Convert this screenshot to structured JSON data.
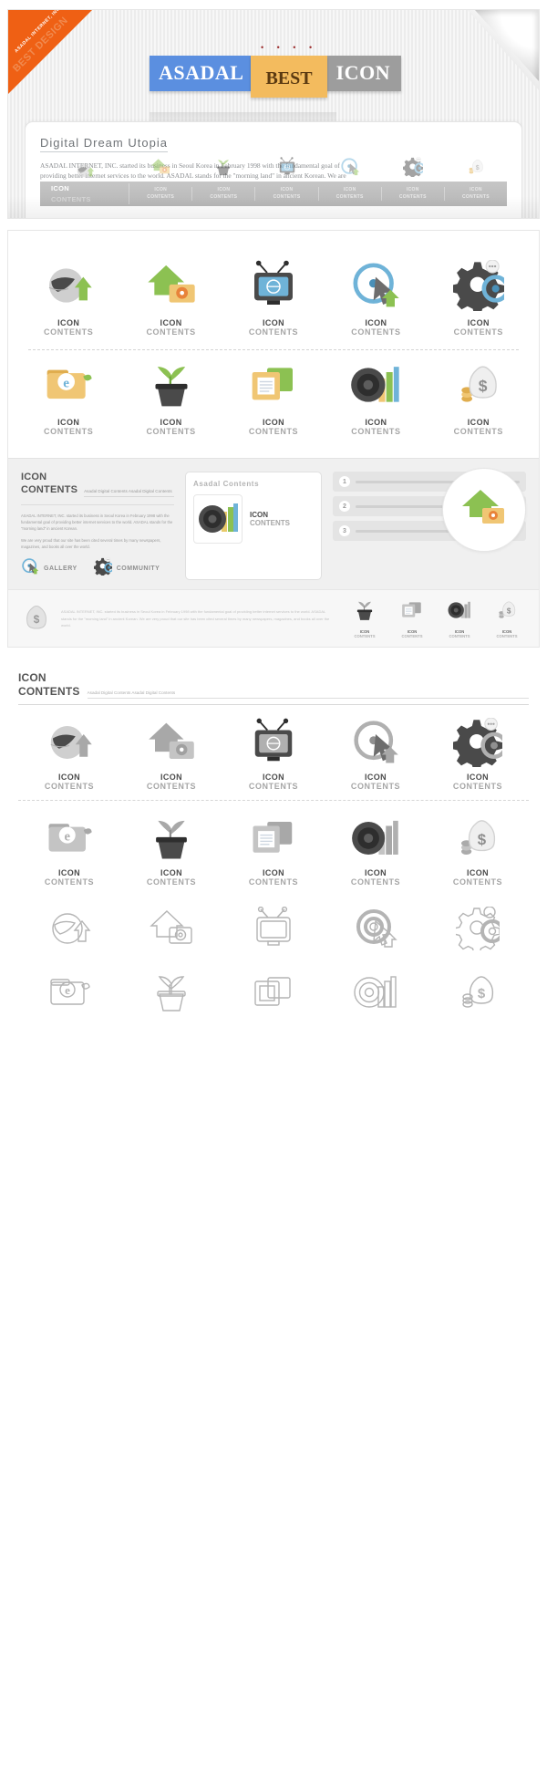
{
  "hero": {
    "ribbon_line1": "ASADAL INTERNET, INC.",
    "ribbon_line2": "BEST DESIGN",
    "logo": {
      "blue": "ASADAL",
      "yellow": "BEST",
      "gray": "ICON",
      "dots": "• • • •"
    },
    "card_title": "Digital  Dream  Utopia",
    "card_body": "ASADAL INTERNET, INC. started its business in Seoul Korea in February 1998 with the fundamental goal of providing better internet services to the world. ASADAL stands for the \"morning land\" in ancient Korean. We are very proud that our site has been cited several times by many newspapers, magazines, and books all over the world.",
    "nav": [
      {
        "l1": "ICON",
        "l2": "CONTENTS",
        "icon": "globe-icon"
      },
      {
        "l1": "ICON",
        "l2": "CONTENTS",
        "icon": "home-mail-icon"
      },
      {
        "l1": "ICON",
        "l2": "CONTENTS",
        "icon": "plant-pot-icon"
      },
      {
        "l1": "ICON",
        "l2": "CONTENTS",
        "icon": "tv-icon"
      },
      {
        "l1": "ICON",
        "l2": "CONTENTS",
        "icon": "target-cursor-icon"
      },
      {
        "l1": "ICON",
        "l2": "CONTENTS",
        "icon": "gear-icon"
      },
      {
        "l1": "ICON",
        "l2": "CONTENTS",
        "icon": "money-bag-icon"
      }
    ]
  },
  "icon_card": {
    "row1": [
      {
        "icon": "globe-arrow-icon",
        "l1": "ICON",
        "l2": "CONTENTS"
      },
      {
        "icon": "home-mail-icon",
        "l1": "ICON",
        "l2": "CONTENTS"
      },
      {
        "icon": "tv-globe-icon",
        "l1": "ICON",
        "l2": "CONTENTS"
      },
      {
        "icon": "target-cursor-icon",
        "l1": "ICON",
        "l2": "CONTENTS"
      },
      {
        "icon": "gear-chat-icon",
        "l1": "ICON",
        "l2": "CONTENTS"
      }
    ],
    "row2": [
      {
        "icon": "folder-internet-icon",
        "l1": "ICON",
        "l2": "CONTENTS"
      },
      {
        "icon": "plant-pot-icon",
        "l1": "ICON",
        "l2": "CONTENTS"
      },
      {
        "icon": "documents-icon",
        "l1": "ICON",
        "l2": "CONTENTS"
      },
      {
        "icon": "speaker-chart-icon",
        "l1": "ICON",
        "l2": "CONTENTS"
      },
      {
        "icon": "money-bag-coins-icon",
        "l1": "ICON",
        "l2": "CONTENTS"
      }
    ]
  },
  "info": {
    "h1": "ICON",
    "h2": "CONTENTS",
    "subtitle": "Asadal Digital Contents  Asadal Digital Contents",
    "p1": "ASADAL INTERNET, INC. started its business in Seoul Korea in February 1998 with the fundamental goal of providing better internet services to the world. ASADAL stands for the \"morning land\" in ancient Korean.",
    "p2": "We are very proud that our site has been cited several times by many newspapers, magazines, and books all over the world.",
    "links": [
      {
        "label": "GALLERY",
        "icon": "target-cursor-icon"
      },
      {
        "label": "COMMUNITY",
        "icon": "gear-chat-icon"
      }
    ],
    "mid_title": "Asadal Contents",
    "mid_l1": "ICON",
    "mid_l2": "CONTENTS",
    "qlist": [
      {
        "num": "1"
      },
      {
        "num": "2"
      },
      {
        "num": "3"
      }
    ],
    "circle_icon": "home-mail-icon"
  },
  "footer": {
    "text": "ASADAL INTERNET, INC. started its business in Seoul Korea in February 1998 with the fundamental goal of providing better internet services to the world. ASADAL stands for the \"morning land\" in ancient Korean. We are very proud that our site has been cited several times by many newspapers, magazines, and books all over the world.",
    "bag_icon": "money-bag-coins-icon",
    "items": [
      {
        "icon": "plant-pot-icon",
        "l1": "ICON",
        "l2": "CONTENTS"
      },
      {
        "icon": "documents-icon",
        "l1": "ICON",
        "l2": "CONTENTS"
      },
      {
        "icon": "speaker-chart-icon",
        "l1": "ICON",
        "l2": "CONTENTS"
      },
      {
        "icon": "money-bag-coins-icon",
        "l1": "ICON",
        "l2": "CONTENTS"
      }
    ]
  },
  "sheet": {
    "h1": "ICON",
    "h2": "CONTENTS",
    "subtitle": "Asadal Digital Contents  Asadal Digital Contents",
    "gray_row1": [
      {
        "icon": "globe-arrow-icon",
        "l1": "ICON",
        "l2": "CONTENTS"
      },
      {
        "icon": "home-mail-icon",
        "l1": "ICON",
        "l2": "CONTENTS"
      },
      {
        "icon": "tv-globe-icon",
        "l1": "ICON",
        "l2": "CONTENTS"
      },
      {
        "icon": "target-cursor-icon",
        "l1": "ICON",
        "l2": "CONTENTS"
      },
      {
        "icon": "gear-chat-icon",
        "l1": "ICON",
        "l2": "CONTENTS"
      }
    ],
    "gray_row2": [
      {
        "icon": "folder-internet-icon",
        "l1": "ICON",
        "l2": "CONTENTS"
      },
      {
        "icon": "plant-pot-icon",
        "l1": "ICON",
        "l2": "CONTENTS"
      },
      {
        "icon": "documents-icon",
        "l1": "ICON",
        "l2": "CONTENTS"
      },
      {
        "icon": "speaker-chart-icon",
        "l1": "ICON",
        "l2": "CONTENTS"
      },
      {
        "icon": "money-bag-coins-icon",
        "l1": "ICON",
        "l2": "CONTENTS"
      }
    ],
    "outline_row1": [
      {
        "icon": "globe-arrow-icon"
      },
      {
        "icon": "home-mail-icon"
      },
      {
        "icon": "tv-globe-icon"
      },
      {
        "icon": "target-cursor-icon"
      },
      {
        "icon": "gear-chat-icon"
      }
    ],
    "outline_row2": [
      {
        "icon": "folder-internet-icon"
      },
      {
        "icon": "plant-pot-icon"
      },
      {
        "icon": "documents-icon"
      },
      {
        "icon": "speaker-chart-icon"
      },
      {
        "icon": "money-bag-coins-icon"
      }
    ]
  },
  "colors": {
    "orange": "#ef6014",
    "blue": "#5b8fe0",
    "yellow": "#f3bb5e",
    "gray": "#9d9d9d",
    "green": "#8cc152",
    "label_dark": "#4c4c4c",
    "label_light": "#a6a6a6"
  }
}
